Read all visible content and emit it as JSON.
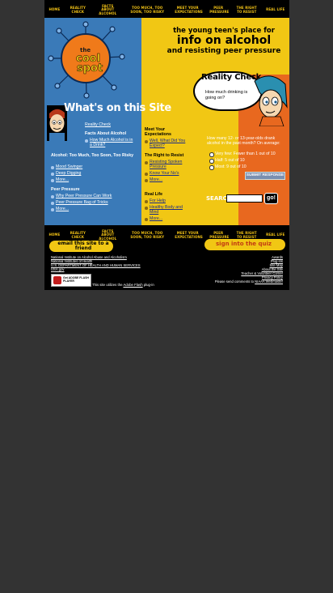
{
  "nav": {
    "items": [
      "HOME",
      "REALITY CHECK",
      "FACTS ABOUT ALCOHOL",
      "TOO MUCH, TOO SOON, TOO RISKY",
      "MEET YOUR EXPECTATIONS",
      "PEER PRESSURE",
      "THE RIGHT TO RESIST",
      "REAL LIFE"
    ]
  },
  "logo": {
    "line1": "the",
    "line2": "cool",
    "line3": "spot"
  },
  "hero": {
    "line1": "the young teen's place for",
    "line2": "info on alcohol",
    "line3": "and resisting peer pressure"
  },
  "reality_check": {
    "title": "Reality Check",
    "question": "How much drinking is going on?",
    "poll_question": "How many 12- or 13-year-olds drank alcohol in the past month? On average:",
    "options": [
      "Very few: Fewer than 1 out of 10",
      "Half: 5 out of 10",
      "Most: 9 out of 10"
    ],
    "submit": "SUBMIT RESPONSE"
  },
  "whats_on": {
    "title": "What's on this Site"
  },
  "col1": {
    "reality_link": "Reality Check",
    "facts_header": "Facts About Alcohol",
    "facts_links": [
      "How Much Alcohol is in a Drink?"
    ],
    "risky_header": "Alcohol: Too Much, Too Soon, Too Risky",
    "risky_links": [
      "Mood Swinger",
      "Deep Digging",
      "More..."
    ],
    "peer_header": "Peer Pressure",
    "peer_links": [
      "Why Peer Pressure Can Work",
      "Peer Pressure Bag of Tricks",
      "More..."
    ]
  },
  "col2": {
    "meet_header": "Meet Your Expectations",
    "meet_links": [
      "Well, What Did You Expect?"
    ],
    "resist_header": "The Right to Resist",
    "resist_links": [
      "Resisting Spoken Pressure",
      "Know Your No's",
      "More..."
    ],
    "real_header": "Real Life",
    "real_links": [
      "For Help",
      "Healthy Body and Mind",
      "More..."
    ]
  },
  "search": {
    "label": "SEARCH",
    "go": "go!",
    "placeholder": ""
  },
  "badges": {
    "email": "email this site to a friend",
    "quiz": "sign into the quiz"
  },
  "footer": {
    "left": [
      "National Institute on Alcohol Abuse and Alcoholism",
      "National Institutes of Health",
      "U.S. DEPARTMENT OF HEALTH AND HUMAN SERVICES",
      "USA.gov"
    ],
    "right": [
      "Awards",
      "Plug-ins",
      "Site Map",
      "About the Site",
      "Teacher & Volunteer Corner",
      "Privacy Policy"
    ],
    "send_prefix": "Please send comments to",
    "send_link": "NIAAA Webmaster",
    "flash_badge": "Get ADOBE FLASH PLAYER",
    "flash_note_prefix": "This site utilizes the",
    "flash_note_link": "Adobe Flash",
    "flash_note_suffix": "plug-in"
  },
  "colors": {
    "blue": "#3a7ab8",
    "yellow": "#f1c714",
    "orange": "#e8681f",
    "background": "#333333"
  }
}
